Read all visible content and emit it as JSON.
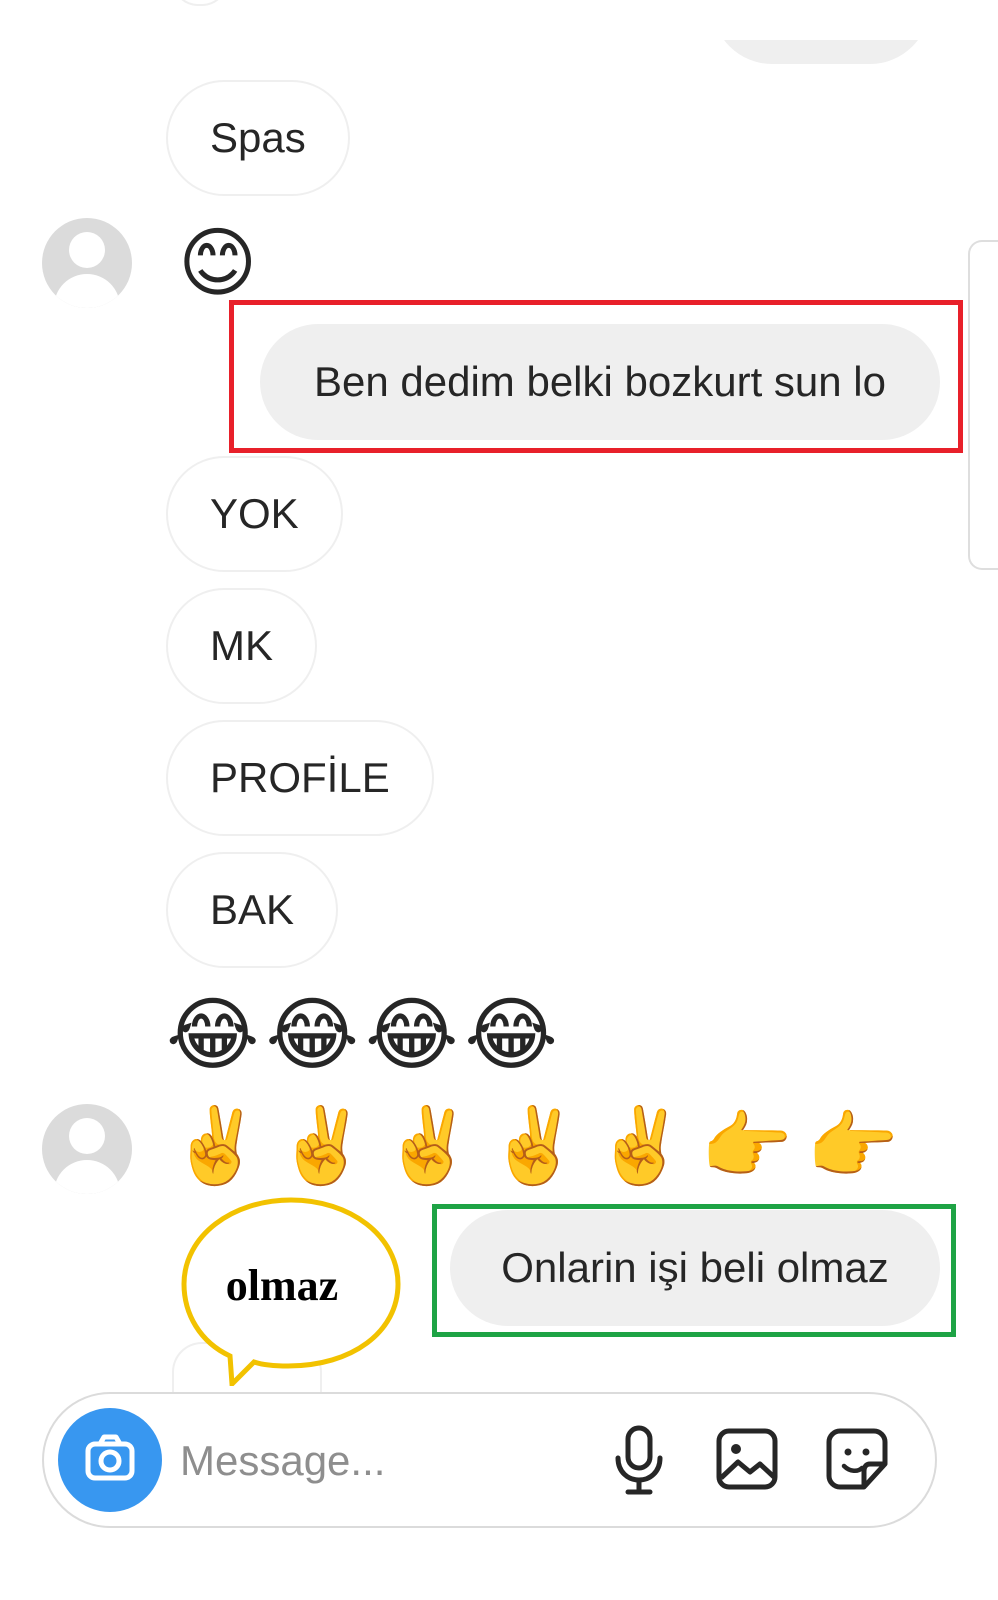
{
  "messages": [
    {
      "id": "m1",
      "text": "Spas"
    },
    {
      "id": "m2",
      "emoji": "😊"
    },
    {
      "id": "m3",
      "text": "Ben dedim belki bozkurt sun lo"
    },
    {
      "id": "m4",
      "text": "YOK"
    },
    {
      "id": "m5",
      "text": "MK"
    },
    {
      "id": "m6",
      "text": "PROFİLE"
    },
    {
      "id": "m7",
      "text": "BAK"
    },
    {
      "id": "m8",
      "emoji": "😂😂😂😂"
    },
    {
      "id": "m9",
      "emoji": "✌️✌️✌️✌️✌️👉👉"
    },
    {
      "id": "m10",
      "text": "Onlarin işi beli olmaz"
    }
  ],
  "annotation": {
    "callout_text": "olmaz",
    "colors": {
      "red_frame": "#e8202a",
      "green_frame": "#1ea345",
      "callout": "#f2c200"
    }
  },
  "composer": {
    "placeholder": "Message...",
    "icons": [
      "camera-icon",
      "microphone-icon",
      "gallery-icon",
      "sticker-icon"
    ],
    "accent": "#3897f0"
  }
}
